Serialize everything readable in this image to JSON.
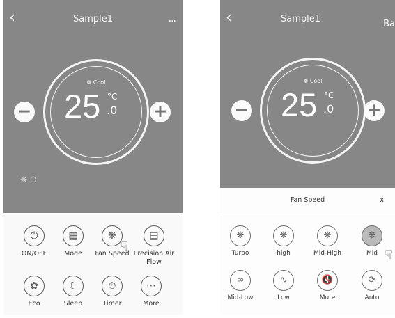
{
  "left_screen": {
    "back_icon": "chevron-left-icon",
    "title": "Sample1",
    "more_label": "...",
    "mode": "Cool",
    "temperature": "25",
    "unit": "°C",
    "decimal": ".0",
    "minus": "−",
    "plus": "+",
    "buttons": [
      {
        "label": "ON/OFF",
        "icon": "power-icon"
      },
      {
        "label": "Mode",
        "icon": "mode-icon"
      },
      {
        "label": "Fan Speed",
        "icon": "fan-icon"
      },
      {
        "label": "Precision Air Flow",
        "icon": "air-flow-icon"
      },
      {
        "label": "Eco",
        "icon": "eco-leaf-icon"
      },
      {
        "label": "Sleep",
        "icon": "sleep-moon-icon"
      },
      {
        "label": "Timer",
        "icon": "timer-icon"
      },
      {
        "label": "More",
        "icon": "more-dots-icon"
      }
    ]
  },
  "right_screen": {
    "back_icon": "chevron-left-icon",
    "title": "Sample1",
    "cut_label": "Ba",
    "mode": "Cool",
    "temperature": "25",
    "unit": "°C",
    "decimal": ".0",
    "minus": "−",
    "plus": "+",
    "sheet": {
      "title": "Fan Speed",
      "close": "x",
      "options": [
        {
          "label": "Turbo",
          "icon": "fan-turbo-icon",
          "selected": false
        },
        {
          "label": "high",
          "icon": "fan-high-icon",
          "selected": false
        },
        {
          "label": "Mid-High",
          "icon": "fan-mid-high-icon",
          "selected": false
        },
        {
          "label": "Mid",
          "icon": "fan-mid-icon",
          "selected": true
        },
        {
          "label": "Mid-Low",
          "icon": "fan-mid-low-icon",
          "selected": false
        },
        {
          "label": "Low",
          "icon": "fan-low-icon",
          "selected": false
        },
        {
          "label": "Mute",
          "icon": "mute-icon",
          "selected": false
        },
        {
          "label": "Auto",
          "icon": "fan-auto-icon",
          "selected": false
        }
      ]
    }
  }
}
